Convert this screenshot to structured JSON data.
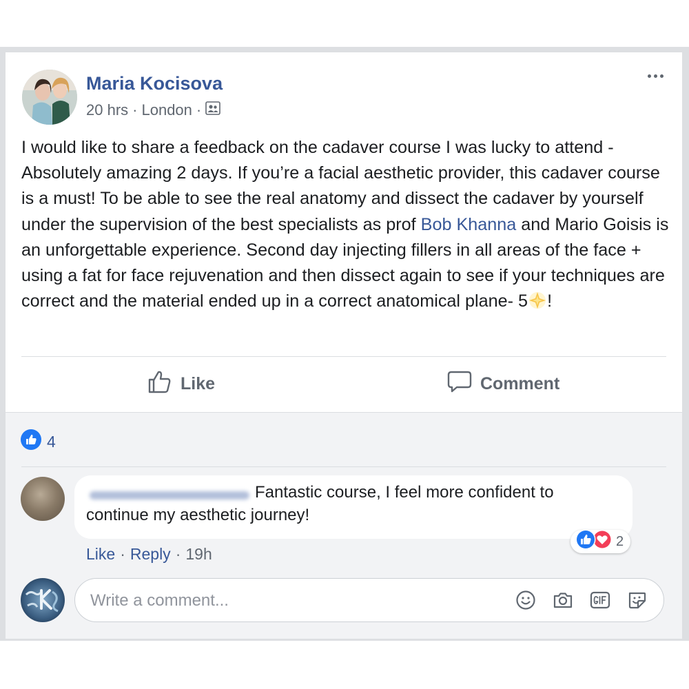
{
  "post": {
    "author": "Maria Kocisova",
    "time": "20 hrs",
    "location": "London",
    "separator": "·",
    "body_part1": "I would like to share a feedback on the cadaver course I was lucky to attend -Absolutely amazing 2 days. If you’re a facial aesthetic provider, this cadaver course is a must! To be able to see the real anatomy and dissect the cadaver by yourself under the supervision of the best specialists as prof ",
    "mention": "Bob Khanna",
    "body_part2": " and Mario Goisis is an unforgettable experience. Second day injecting fillers in all areas of the face + using a fat for face rejuvenation and then dissect again to see if your techniques are correct and the material ended up in a correct anatomical plane- 5",
    "body_end": "!",
    "audience_icon": "friends-icon",
    "more_icon": "more-dots-icon"
  },
  "actions": {
    "like_label": "Like",
    "comment_label": "Comment"
  },
  "reactions": {
    "count": "4",
    "icon": "like-reaction-icon"
  },
  "comment": {
    "line1": "Fantastic course, I feel more confident to",
    "line2": "continue my aesthetic journey!",
    "reaction_count": "2",
    "like_label": "Like",
    "reply_label": "Reply",
    "separator": "·",
    "time": "19h"
  },
  "composer": {
    "placeholder": "Write a comment...",
    "icons": [
      "emoji-icon",
      "camera-icon",
      "gif-icon",
      "sticker-icon"
    ]
  },
  "colors": {
    "link": "#385898",
    "secondary_text": "#606770",
    "like_blue": "#2078f4",
    "love_red": "#f33e58",
    "panel_bg": "#f2f3f5"
  }
}
